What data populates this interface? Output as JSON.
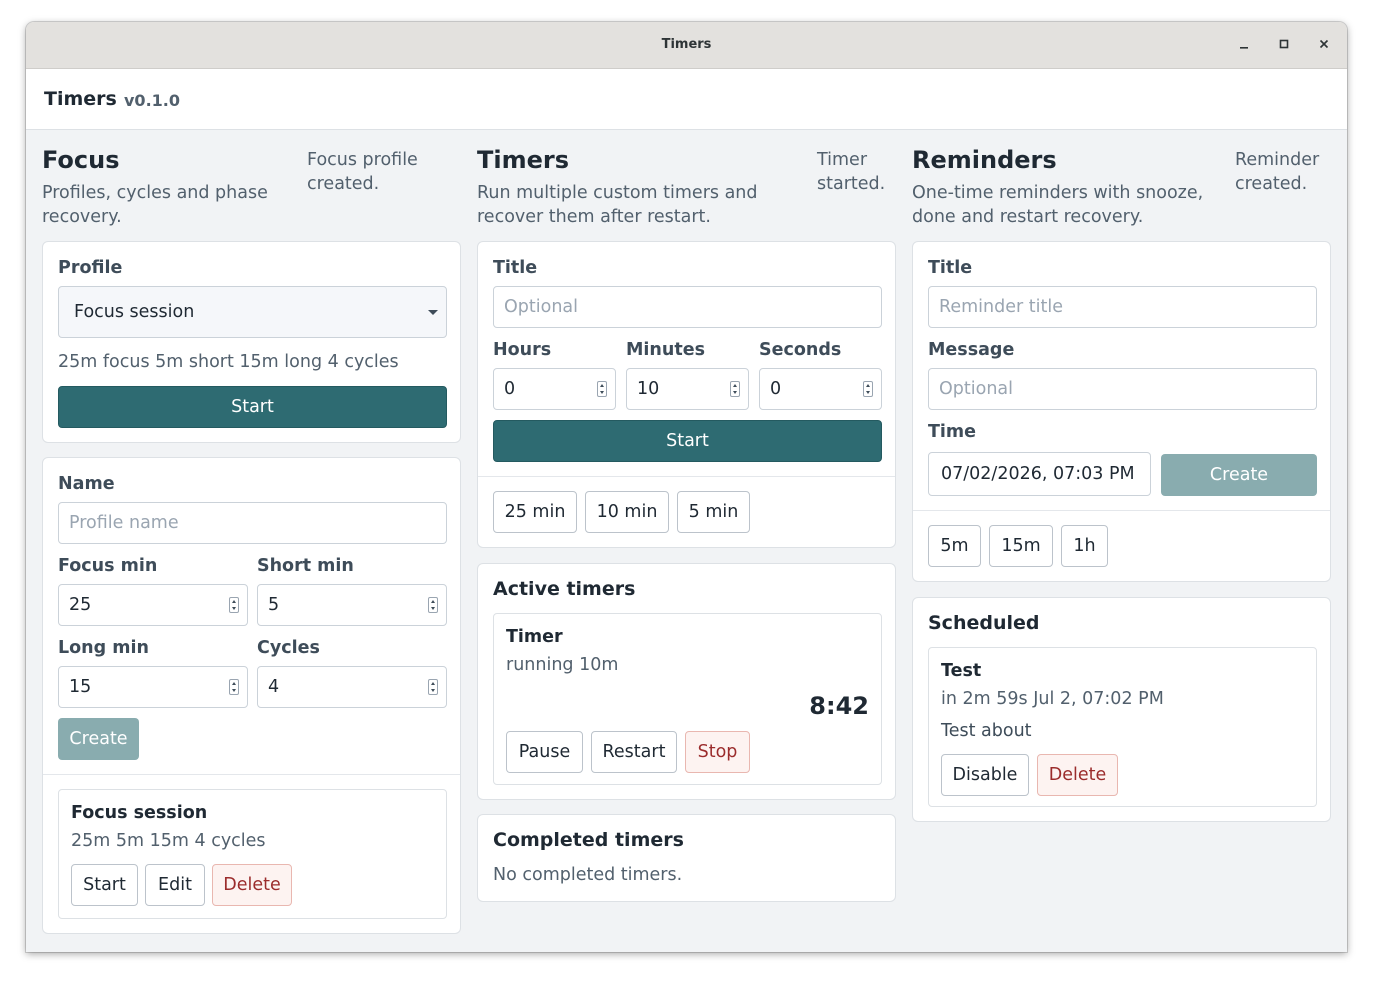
{
  "window": {
    "title": "Timers"
  },
  "app": {
    "name": "Timers",
    "version": "v0.1.0"
  },
  "focus": {
    "title": "Focus",
    "subtitle": "Profiles, cycles and phase recovery.",
    "status": "Focus profile created.",
    "profile_label": "Profile",
    "profile_selected": "Focus session",
    "summary": "25m focus  5m short  15m long  4 cycles",
    "start_label": "Start",
    "form": {
      "name_label": "Name",
      "name_placeholder": "Profile name",
      "focus_label": "Focus min",
      "focus_value": "25",
      "short_label": "Short min",
      "short_value": "5",
      "long_label": "Long min",
      "long_value": "15",
      "cycles_label": "Cycles",
      "cycles_value": "4",
      "create_label": "Create"
    },
    "profiles": [
      {
        "name": "Focus session",
        "summary": "25m  5m  15m  4 cycles",
        "start": "Start",
        "edit": "Edit",
        "delete": "Delete"
      }
    ]
  },
  "timers": {
    "title": "Timers",
    "subtitle": "Run multiple custom timers and recover them after restart.",
    "status": "Timer started.",
    "form": {
      "title_label": "Title",
      "title_placeholder": "Optional",
      "hours_label": "Hours",
      "hours_value": "0",
      "minutes_label": "Minutes",
      "minutes_value": "10",
      "seconds_label": "Seconds",
      "seconds_value": "0",
      "start_label": "Start"
    },
    "presets": [
      "25 min",
      "10 min",
      "5 min"
    ],
    "active_title": "Active timers",
    "active": [
      {
        "name": "Timer",
        "meta": "running  10m",
        "remaining": "8:42",
        "pause": "Pause",
        "restart": "Restart",
        "stop": "Stop"
      }
    ],
    "completed_title": "Completed timers",
    "completed_empty": "No completed timers."
  },
  "reminders": {
    "title": "Reminders",
    "subtitle": "One-time reminders with snooze, done and restart recovery.",
    "status": "Reminder created.",
    "form": {
      "title_label": "Title",
      "title_placeholder": "Reminder title",
      "message_label": "Message",
      "message_placeholder": "Optional",
      "time_label": "Time",
      "time_value": "07/02/2026, 07:03 PM",
      "create_label": "Create"
    },
    "presets": [
      "5m",
      "15m",
      "1h"
    ],
    "scheduled_title": "Scheduled",
    "scheduled": [
      {
        "name": "Test",
        "when": "in 2m 59s  Jul 2, 07:02 PM",
        "message": "Test about",
        "disable": "Disable",
        "delete": "Delete"
      }
    ]
  }
}
